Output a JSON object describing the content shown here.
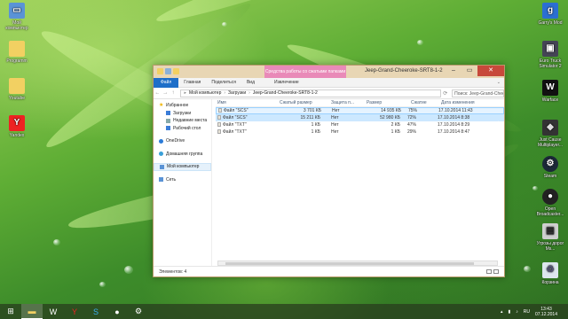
{
  "desktop": {
    "left_icons": [
      {
        "label": "Мой компьютер",
        "icon": "computer-icon"
      },
      {
        "label": "Programm",
        "icon": "folder-icon"
      },
      {
        "label": "Youtube",
        "icon": "folder-icon"
      },
      {
        "label": "Yandex",
        "icon": "yandex-icon"
      }
    ],
    "right_icons": [
      {
        "label": "Garry's Mod",
        "icon": "gmod-icon"
      },
      {
        "label": "Euro Truck Simulator 2",
        "icon": "truck-icon"
      },
      {
        "label": "Warface",
        "icon": "warface-icon"
      },
      {
        "label": "Just Cause Multiplayer...",
        "icon": "jc-icon"
      },
      {
        "label": "Steam",
        "icon": "steam-icon"
      },
      {
        "label": "Open Broadcaster...",
        "icon": "obs-icon"
      },
      {
        "label": "Угрозы дорог Ms...",
        "icon": "app-icon"
      },
      {
        "label": "Корзина",
        "icon": "recycle-bin-icon"
      }
    ]
  },
  "window": {
    "title": "Jeep-Grand-Cheeroke-SRT8-1-2",
    "context_tab": "Средства работы со сжатыми папками",
    "ribbon_tabs": [
      "Файл",
      "Главная",
      "Поделиться",
      "Вид",
      "Извлечение"
    ],
    "breadcrumb": [
      "Мой компьютер",
      "Загрузки",
      "Jeep-Grand-Cheeroke-SRT8-1-2"
    ],
    "search_placeholder": "Поиск: Jeep-Grand-Cheeroke...",
    "nav": {
      "favorites": "Избранное",
      "downloads": "Загрузки",
      "recent": "Недавние места",
      "desktop": "Рабочий стол",
      "onedrive": "OneDrive",
      "homegroup": "Домашняя группа",
      "computer": "Мой компьютер",
      "network": "Сеть"
    },
    "columns": [
      "Имя",
      "Сжатый размер",
      "Защита п...",
      "Размер",
      "Сжатие",
      "Дата изменения"
    ],
    "rows": [
      [
        "Файл \"SCS\"",
        "3 701 КБ",
        "Нет",
        "14 935 КБ",
        "75%",
        "17.10.2014 11:43"
      ],
      [
        "Файл \"SCS\"",
        "15 211 КБ",
        "Нет",
        "52 980 КБ",
        "72%",
        "17.10.2014 8:38"
      ],
      [
        "Файл \"TXT\"",
        "1 КБ",
        "Нет",
        "2 КБ",
        "47%",
        "17.10.2014 8:29"
      ],
      [
        "Файл \"TXT\"",
        "1 КБ",
        "Нет",
        "1 КБ",
        "29%",
        "17.10.2014 8:47"
      ]
    ],
    "status": "Элементов: 4"
  },
  "taskbar": {
    "lang": "RU",
    "time": "13:43",
    "date": "07.12.2014"
  },
  "colors": {
    "accent": "#1e6fc9",
    "context_tab": "#e98ab8",
    "close": "#c7493b"
  }
}
